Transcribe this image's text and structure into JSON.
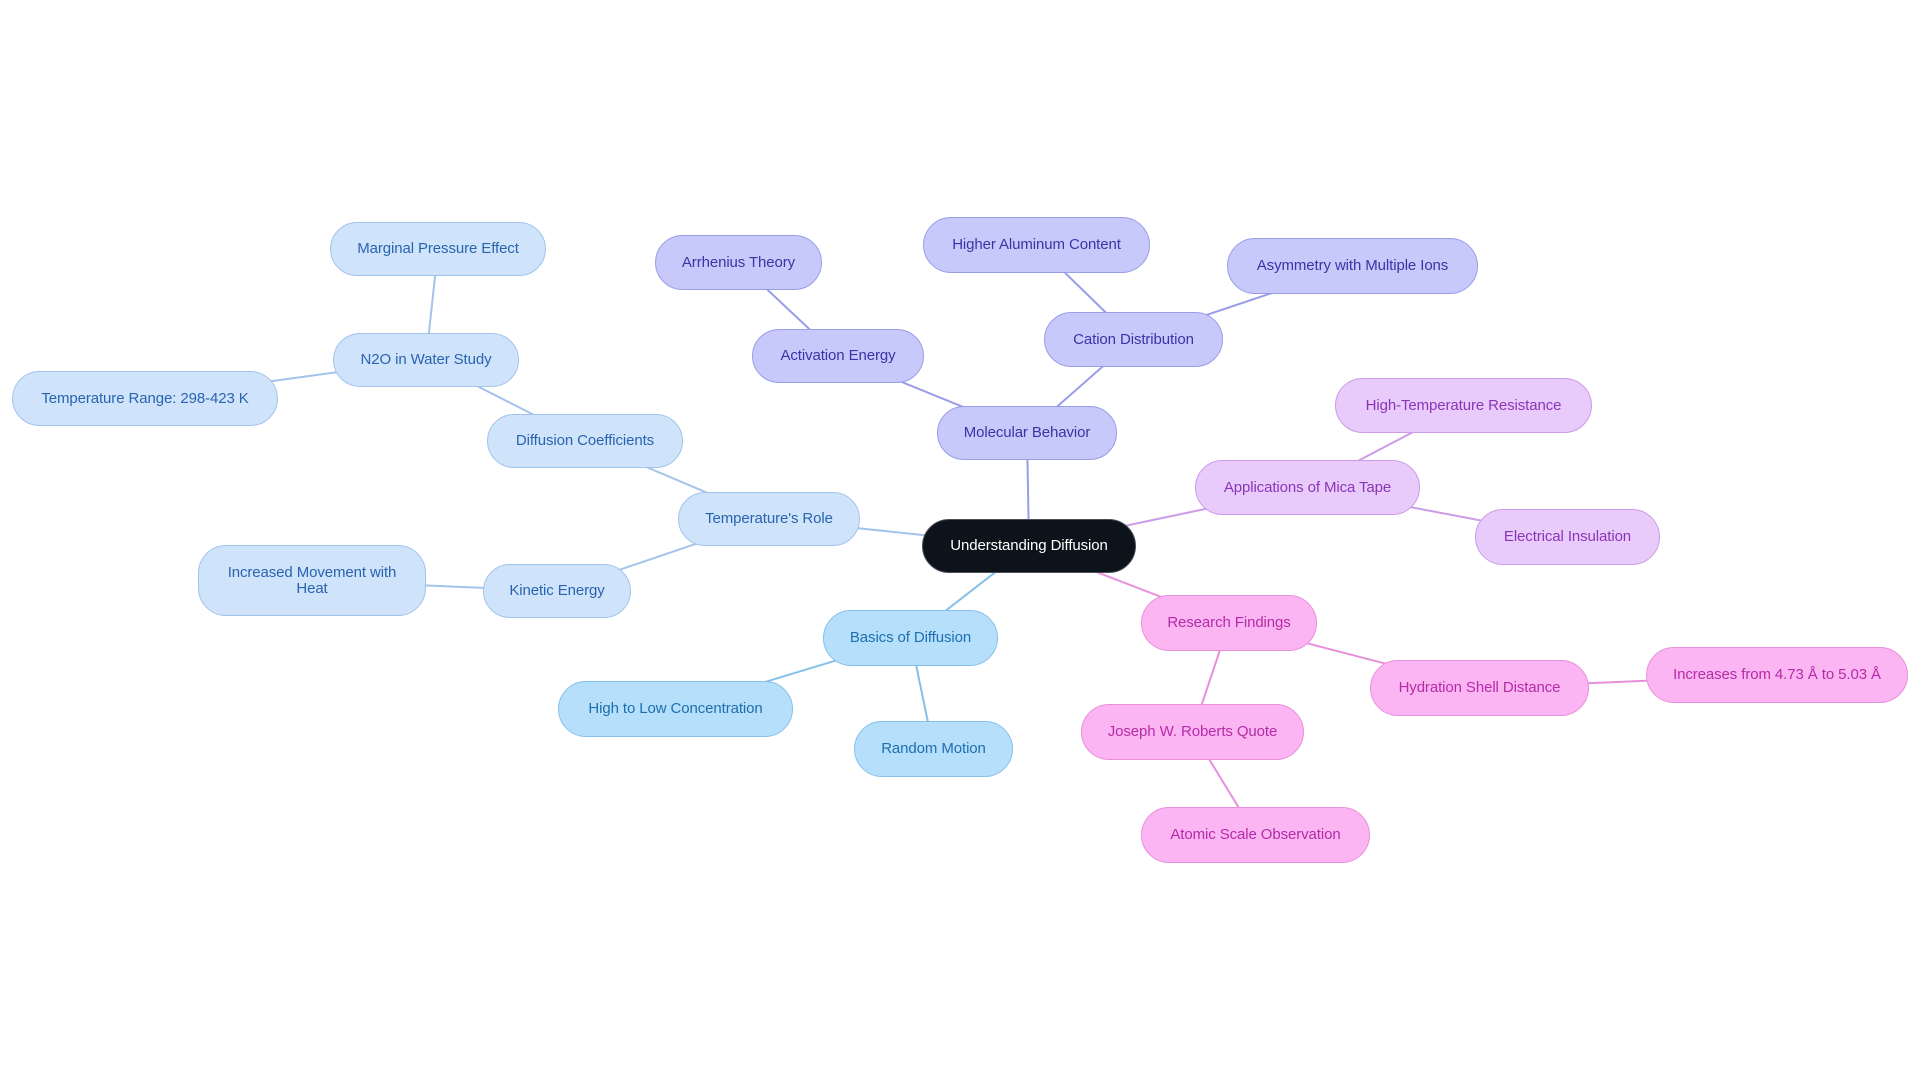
{
  "title": "Understanding Diffusion",
  "colors": {
    "root_fill": "#0d131a",
    "temperature_branch": "#a3c4ea",
    "basics_branch": "#86c0ea",
    "molecular_branch": "#9a9de8",
    "mica_branch": "#cc9ce8",
    "research_branch": "#e890dc"
  },
  "nodes": {
    "root": "Understanding Diffusion",
    "temperatures_role": "Temperature's Role",
    "diffusion_coefficients": "Diffusion Coefficients",
    "n2o_in_water_study": "N2O in Water Study",
    "marginal_pressure_effect": "Marginal Pressure Effect",
    "temperature_range": "Temperature Range: 298-423 K",
    "kinetic_energy": "Kinetic Energy",
    "increased_movement_with_heat": "Increased Movement with Heat",
    "molecular_behavior": "Molecular Behavior",
    "activation_energy": "Activation Energy",
    "arrhenius_theory": "Arrhenius Theory",
    "cation_distribution": "Cation Distribution",
    "higher_aluminum_content": "Higher Aluminum Content",
    "asymmetry_with_multiple_ions": "Asymmetry with Multiple Ions",
    "applications_of_mica_tape": "Applications of Mica Tape",
    "high_temperature_resistance": "High-Temperature Resistance",
    "electrical_insulation": "Electrical Insulation",
    "research_findings": "Research Findings",
    "hydration_shell_distance": "Hydration Shell Distance",
    "increases_from": "Increases from 4.73 Å to 5.03 Å",
    "joseph_w_roberts_quote": "Joseph W. Roberts Quote",
    "atomic_scale_observation": "Atomic Scale Observation",
    "basics_of_diffusion": "Basics of Diffusion",
    "high_to_low_concentration": "High to Low Concentration",
    "random_motion": "Random Motion"
  },
  "edges": [
    [
      "root",
      "temperatures_role"
    ],
    [
      "temperatures_role",
      "diffusion_coefficients"
    ],
    [
      "diffusion_coefficients",
      "n2o_in_water_study"
    ],
    [
      "n2o_in_water_study",
      "marginal_pressure_effect"
    ],
    [
      "n2o_in_water_study",
      "temperature_range"
    ],
    [
      "temperatures_role",
      "kinetic_energy"
    ],
    [
      "kinetic_energy",
      "increased_movement_with_heat"
    ],
    [
      "root",
      "molecular_behavior"
    ],
    [
      "molecular_behavior",
      "activation_energy"
    ],
    [
      "activation_energy",
      "arrhenius_theory"
    ],
    [
      "molecular_behavior",
      "cation_distribution"
    ],
    [
      "cation_distribution",
      "higher_aluminum_content"
    ],
    [
      "cation_distribution",
      "asymmetry_with_multiple_ions"
    ],
    [
      "root",
      "applications_of_mica_tape"
    ],
    [
      "applications_of_mica_tape",
      "high_temperature_resistance"
    ],
    [
      "applications_of_mica_tape",
      "electrical_insulation"
    ],
    [
      "root",
      "research_findings"
    ],
    [
      "research_findings",
      "hydration_shell_distance"
    ],
    [
      "hydration_shell_distance",
      "increases_from"
    ],
    [
      "research_findings",
      "joseph_w_roberts_quote"
    ],
    [
      "joseph_w_roberts_quote",
      "atomic_scale_observation"
    ],
    [
      "root",
      "basics_of_diffusion"
    ],
    [
      "basics_of_diffusion",
      "high_to_low_concentration"
    ],
    [
      "basics_of_diffusion",
      "random_motion"
    ]
  ]
}
